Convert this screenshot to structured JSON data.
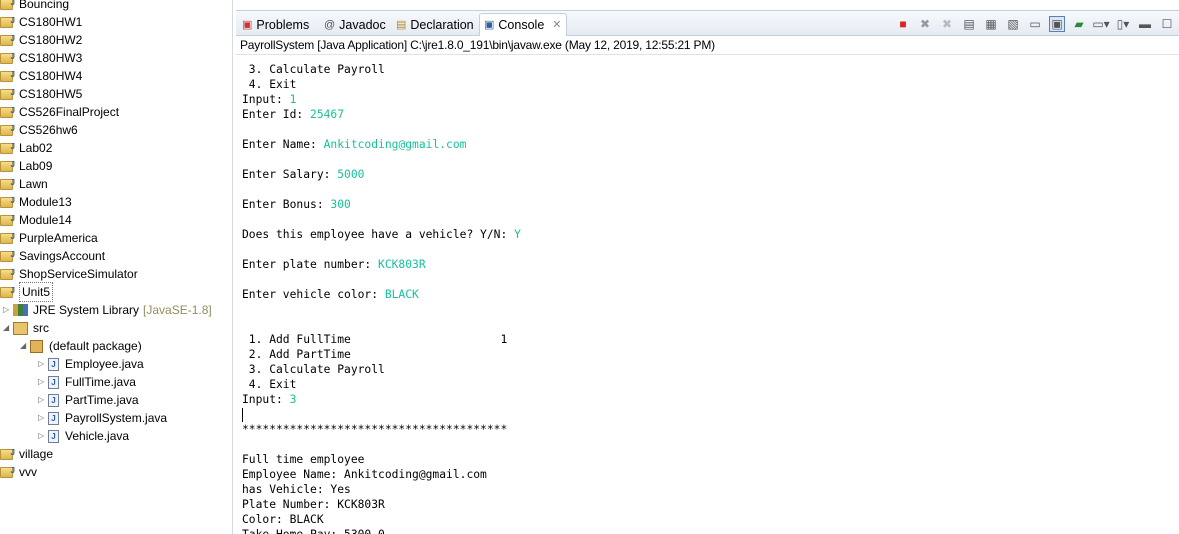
{
  "explorer": {
    "projects": [
      "Bouncing",
      "CS180HW1",
      "CS180HW2",
      "CS180HW3",
      "CS180HW4",
      "CS180HW5",
      "CS526FinalProject",
      "CS526hw6",
      "Lab02",
      "Lab09",
      "Lawn",
      "Module13",
      "Module14",
      "PurpleAmerica",
      "SavingsAccount",
      "ShopServiceSimulator",
      "Unit5"
    ],
    "jre": {
      "label": "JRE System Library",
      "version": "[JavaSE-1.8]"
    },
    "src": "src",
    "package": "(default package)",
    "files": [
      "Employee.java",
      "FullTime.java",
      "PartTime.java",
      "PayrollSystem.java",
      "Vehicle.java"
    ],
    "after": [
      "village",
      "vvv"
    ]
  },
  "tabs": [
    {
      "label": "Problems",
      "icon": "problems-icon"
    },
    {
      "label": "Javadoc",
      "icon": "at-icon"
    },
    {
      "label": "Declaration",
      "icon": "declaration-icon"
    },
    {
      "label": "Console",
      "icon": "console-icon",
      "active": true
    }
  ],
  "process_title": "PayrollSystem [Java Application] C:\\jre1.8.0_191\\bin\\javaw.exe (May 12, 2019, 12:55:21 PM)",
  "input_color": "#17c19a",
  "console_lines": [
    [
      [
        " 3. Calculate Payroll",
        false
      ]
    ],
    [
      [
        " 4. Exit",
        false
      ]
    ],
    [
      [
        "Input: ",
        false
      ],
      [
        "1",
        true
      ]
    ],
    [
      [
        "Enter Id: ",
        false
      ],
      [
        "25467",
        true
      ]
    ],
    [],
    [
      [
        "Enter Name: ",
        false
      ],
      [
        "Ankitcoding@gmail.com",
        true
      ]
    ],
    [],
    [
      [
        "Enter Salary: ",
        false
      ],
      [
        "5000",
        true
      ]
    ],
    [],
    [
      [
        "Enter Bonus: ",
        false
      ],
      [
        "300",
        true
      ]
    ],
    [],
    [
      [
        "Does this employee have a vehicle? Y/N: ",
        false
      ],
      [
        "Y",
        true
      ]
    ],
    [],
    [
      [
        "Enter plate number: ",
        false
      ],
      [
        "KCK803R",
        true
      ]
    ],
    [],
    [
      [
        "Enter vehicle color: ",
        false
      ],
      [
        "BLACK",
        true
      ]
    ],
    [],
    [],
    [
      [
        " 1. Add FullTime                      1",
        false
      ]
    ],
    [
      [
        " 2. Add PartTime",
        false
      ]
    ],
    [
      [
        " 3. Calculate Payroll",
        false
      ]
    ],
    [
      [
        " 4. Exit",
        false
      ]
    ],
    [
      [
        "Input: ",
        false
      ],
      [
        "3",
        true
      ]
    ],
    [],
    [
      [
        "***************************************",
        false
      ]
    ],
    [],
    [
      [
        "Full time employee",
        false
      ]
    ],
    [
      [
        "Employee Name: Ankitcoding@gmail.com",
        false
      ]
    ],
    [
      [
        "has Vehicle: Yes",
        false
      ]
    ],
    [
      [
        "Plate Number: KCK803R",
        false
      ]
    ],
    [
      [
        "Color: BLACK",
        false
      ]
    ],
    [
      [
        "Take Home Pay: 5300.0",
        false
      ]
    ]
  ]
}
